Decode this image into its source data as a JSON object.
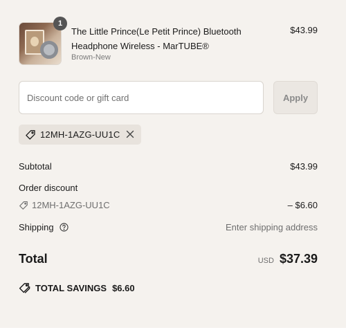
{
  "cart_item": {
    "quantity": "1",
    "name": "The Little Prince(Le Petit Prince) Bluetooth Headphone Wireless - MarTUBE®",
    "variant": "Brown-New",
    "price": "$43.99",
    "image_icon": "product-photo"
  },
  "discount": {
    "placeholder": "Discount code or gift card",
    "value": "",
    "apply_label": "Apply",
    "applied_code": "12MH-1AZG-UU1C"
  },
  "summary": {
    "subtotal_label": "Subtotal",
    "subtotal_value": "$43.99",
    "order_discount_label": "Order discount",
    "discount_code": "12MH-1AZG-UU1C",
    "discount_value": "– $6.60",
    "shipping_label": "Shipping",
    "shipping_value": "Enter shipping address",
    "total_label": "Total",
    "currency": "USD",
    "total_value": "$37.39",
    "savings_label": "TOTAL SAVINGS",
    "savings_value": "$6.60"
  },
  "icons": {
    "tag": "tag-icon",
    "remove": "close-icon",
    "help": "question-circle-icon",
    "savings": "savings-tags-icon"
  },
  "colors": {
    "background": "#f5f2ee",
    "chip_background": "#e8e3dd",
    "apply_button": "#ebe7e2",
    "text": "#1a1a1a",
    "muted_text": "#6e6e6e",
    "badge": "#555555"
  }
}
